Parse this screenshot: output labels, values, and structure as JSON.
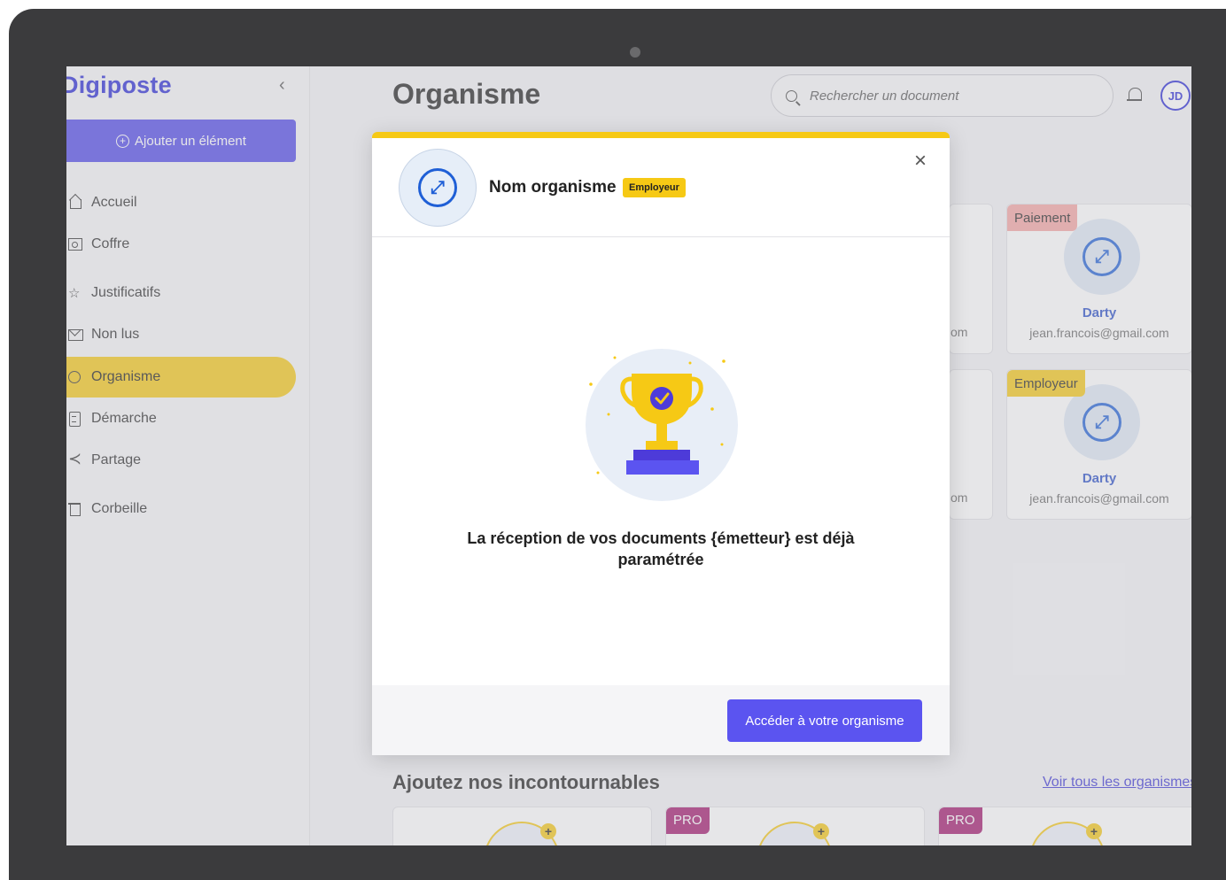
{
  "app": {
    "logo_text": "Digiposte"
  },
  "sidebar": {
    "collapse_glyph": "‹",
    "add_button_label": "Ajouter un élément",
    "items": [
      {
        "label": "Accueil"
      },
      {
        "label": "Coffre"
      },
      {
        "label": "Justificatifs"
      },
      {
        "label": "Non lus"
      },
      {
        "label": "Organisme",
        "active": true
      },
      {
        "label": "Démarche"
      },
      {
        "label": "Partage"
      },
      {
        "label": "Corbeille"
      }
    ]
  },
  "header": {
    "title": "Organisme",
    "search_placeholder": "Rechercher un document",
    "avatar_initials": "JD"
  },
  "cards": [
    {
      "tag": "Paiement",
      "tag_color": "#f5a5a3",
      "name": "Darty",
      "email": "jean.francois@gmail.com"
    },
    {
      "tag": "Employeur",
      "tag_color": "#f6c915",
      "name": "Darty",
      "email": "jean.francois@gmail.com"
    }
  ],
  "partial_text": "om",
  "section": {
    "title": "Ajoutez nos incontournables",
    "see_all": "Voir tous les organismes",
    "pro_badge": "PRO"
  },
  "modal": {
    "org_name": "Nom organisme",
    "badge": "Employeur",
    "message": "La réception de vos documents {émetteur} est déjà paramétrée",
    "cta_label": "Accéder à votre organisme"
  },
  "colors": {
    "primary": "#5b54f0",
    "accent": "#f6c915",
    "logo": "#2a2ad6",
    "payment_tag": "#f5a5a3",
    "pro_tag": "#a3196e"
  }
}
